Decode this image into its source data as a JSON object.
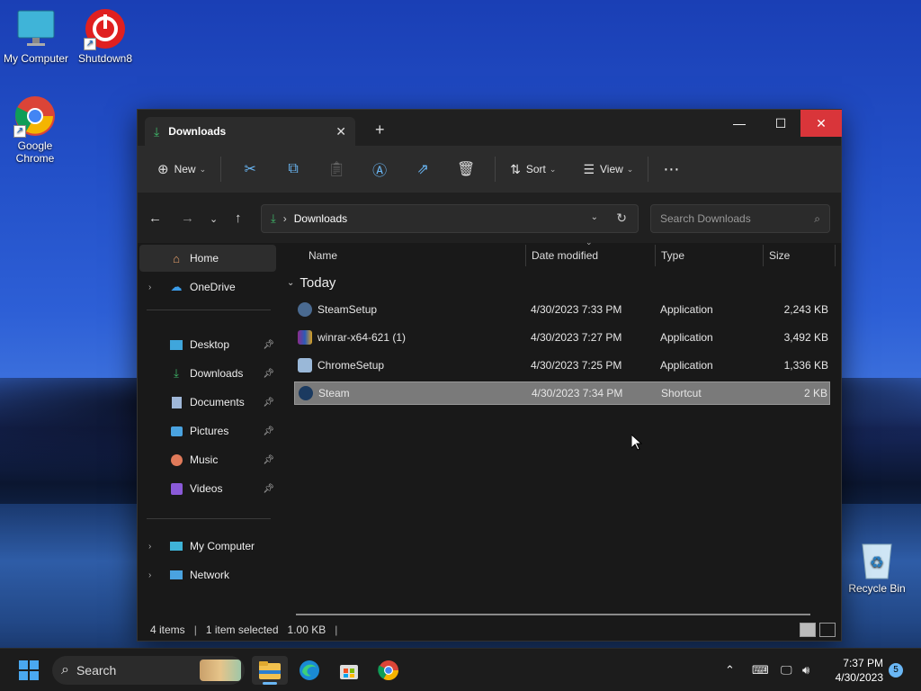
{
  "desktop": {
    "icons": [
      {
        "label": "My Computer",
        "icon": "monitor-icon"
      },
      {
        "label": "Shutdown8",
        "icon": "power-icon"
      },
      {
        "label": "Google Chrome",
        "icon": "chrome-icon"
      },
      {
        "label": "Recycle Bin",
        "icon": "recycle-bin-icon"
      }
    ]
  },
  "window": {
    "tab_title": "Downloads",
    "toolbar": {
      "new_label": "New",
      "sort_label": "Sort",
      "view_label": "View"
    },
    "address": {
      "path": "Downloads",
      "search_placeholder": "Search Downloads"
    },
    "sidebar": {
      "items": [
        {
          "label": "Home"
        },
        {
          "label": "OneDrive"
        },
        {
          "label": "Desktop"
        },
        {
          "label": "Downloads"
        },
        {
          "label": "Documents"
        },
        {
          "label": "Pictures"
        },
        {
          "label": "Music"
        },
        {
          "label": "Videos"
        },
        {
          "label": "My Computer"
        },
        {
          "label": "Network"
        }
      ]
    },
    "columns": {
      "name": "Name",
      "date": "Date modified",
      "type": "Type",
      "size": "Size"
    },
    "group": "Today",
    "files": [
      {
        "name": "SteamSetup",
        "date": "4/30/2023 7:33 PM",
        "type": "Application",
        "size": "2,243 KB",
        "icon": "steam-setup-icon"
      },
      {
        "name": "winrar-x64-621 (1)",
        "date": "4/30/2023 7:27 PM",
        "type": "Application",
        "size": "3,492 KB",
        "icon": "winrar-icon"
      },
      {
        "name": "ChromeSetup",
        "date": "4/30/2023 7:25 PM",
        "type": "Application",
        "size": "1,336 KB",
        "icon": "chrome-setup-icon"
      },
      {
        "name": "Steam",
        "date": "4/30/2023 7:34 PM",
        "type": "Shortcut",
        "size": "2 KB",
        "icon": "steam-icon"
      }
    ],
    "status": {
      "count": "4 items",
      "selected": "1 item selected",
      "size": "1.00 KB"
    }
  },
  "taskbar": {
    "search_label": "Search",
    "time": "7:37 PM",
    "date": "4/30/2023",
    "notification_count": "5"
  }
}
